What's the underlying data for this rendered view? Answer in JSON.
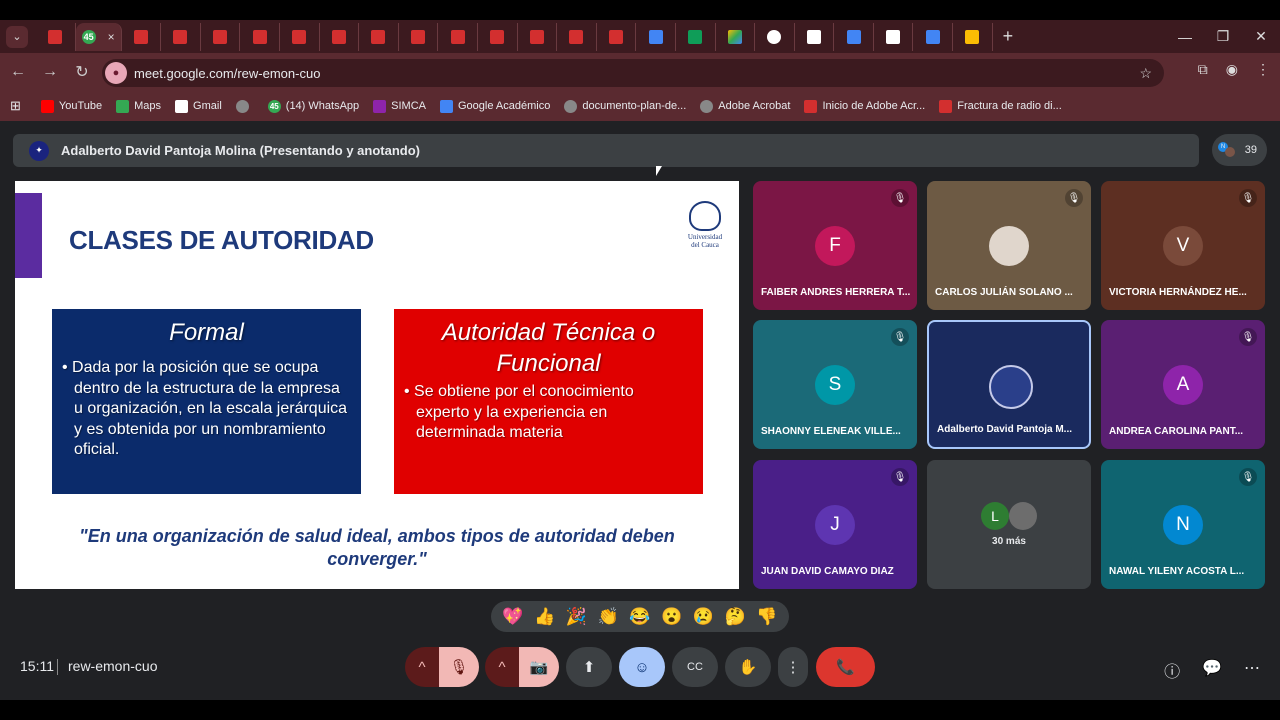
{
  "browser": {
    "active_tab_close": "×",
    "new_tab": "+",
    "window_controls": [
      "—",
      "❐",
      "✕"
    ],
    "url": "meet.google.com/rew-emon-cuo",
    "tab_favicons": [
      "pdf",
      "green",
      "pdf",
      "pdf",
      "pdf",
      "pdf",
      "pdf",
      "pdf",
      "pdf",
      "pdf",
      "pdf",
      "pdf",
      "pdf",
      "pdf",
      "pdf",
      "doc",
      "sheet",
      "drive",
      "gpt",
      "gmail",
      "doc",
      "gmail",
      "doc",
      "slides"
    ],
    "active_tab_badge": "45"
  },
  "bookmarks": [
    {
      "label": "YouTube",
      "icon": "yt"
    },
    {
      "label": "Maps",
      "icon": "maps"
    },
    {
      "label": "Gmail",
      "icon": "gmail"
    },
    {
      "label": "",
      "icon": "globe"
    },
    {
      "label": "(14) WhatsApp",
      "icon": "green",
      "badge": "45"
    },
    {
      "label": "SIMCA",
      "icon": "simca"
    },
    {
      "label": "Google Académico",
      "icon": "scholar"
    },
    {
      "label": "documento-plan-de...",
      "icon": "globe"
    },
    {
      "label": "Adobe Acrobat",
      "icon": "globe"
    },
    {
      "label": "Inicio de Adobe Acr...",
      "icon": "pdf"
    },
    {
      "label": "Fractura de radio di...",
      "icon": "pdf"
    }
  ],
  "meet": {
    "presenter_banner": "Adalberto David Pantoja Molina (Presentando y anotando)",
    "participant_count": "39",
    "time": "15:11",
    "meeting_code": "rew-emon-cuo"
  },
  "slide": {
    "title": "CLASES DE AUTORIDAD",
    "seal_text": "Universidad del Cauca",
    "box_formal_title": "Formal",
    "box_formal_body": "• Dada por la posición que se ocupa dentro de la estructura de la empresa u organización, en la escala jerárquica y es obtenida por un nombramiento oficial.",
    "box_tech_title": "Autoridad Técnica o Funcional",
    "box_tech_body": "• Se obtiene por el conocimiento experto y la experiencia en determinada materia",
    "quote": "\"En una organización de salud ideal, ambos tipos de autoridad deben converger.\""
  },
  "participants": [
    {
      "name": "FAIBER ANDRES HERRERA T...",
      "initial": "F",
      "bg": "#7b1645",
      "avatar": "#c2185b",
      "muted": true
    },
    {
      "name": "CARLOS JULIÁN SOLANO ...",
      "initial": "",
      "bg": "#6d5a44",
      "avatar": "#e0d6cc",
      "muted": true
    },
    {
      "name": "VICTORIA HERNÁNDEZ HE...",
      "initial": "V",
      "bg": "#5d2f22",
      "avatar": "#7a4a3a",
      "muted": true
    },
    {
      "name": "SHAONNY ELENEAK VILLE...",
      "initial": "S",
      "bg": "#1b6a78",
      "avatar": "#0097a7",
      "muted": true
    },
    {
      "name": "Adalberto David Pantoja M...",
      "initial": "",
      "bg": "#1a2a5e",
      "avatar": "#2a3f8a",
      "muted": false
    },
    {
      "name": "ANDREA CAROLINA PANT...",
      "initial": "A",
      "bg": "#5a1f72",
      "avatar": "#8e24aa",
      "muted": true
    },
    {
      "name": "JUAN DAVID CAMAYO DIAZ",
      "initial": "J",
      "bg": "#4a1f88",
      "avatar": "#5e35b1",
      "muted": true
    },
    {
      "name": "",
      "initial": "L",
      "bg": "#3c4043",
      "avatar": "#2e7d32",
      "muted": false
    },
    {
      "name": "NAWAL YILENY ACOSTA L...",
      "initial": "N",
      "bg": "#0f6470",
      "avatar": "#0288d1",
      "muted": true
    }
  ],
  "more": {
    "label": "30 más"
  },
  "reactions": [
    "💖",
    "👍",
    "🎉",
    "👏",
    "😂",
    "😮",
    "😢",
    "🤔",
    "👎"
  ],
  "controls": {
    "caret": "^",
    "mic": "🎙",
    "camera": "📷",
    "present": "⬆",
    "emoji": "☺",
    "captions": "CC",
    "hand": "✋",
    "more": "⋮",
    "hangup": "📞",
    "info": "ⓘ",
    "chat": "💬",
    "activities": "⋯"
  }
}
